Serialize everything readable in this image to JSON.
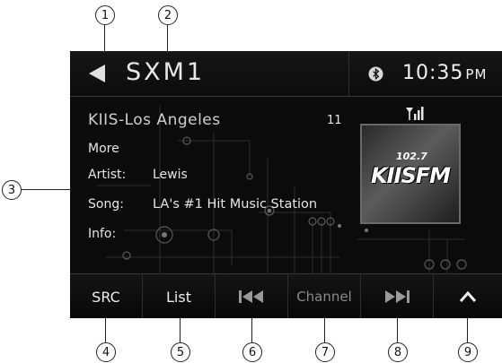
{
  "callouts": [
    "1",
    "2",
    "3",
    "4",
    "5",
    "6",
    "7",
    "8",
    "9"
  ],
  "header": {
    "source": "SXM1",
    "time": "10:35",
    "ampm": "PM",
    "back_icon": "back-triangle-icon",
    "bluetooth_icon": "bluetooth-icon"
  },
  "station": {
    "name": "KIIS-Los Angeles",
    "channel": "11",
    "more": "More",
    "artist_label": "Artist:",
    "artist": "Lewis",
    "song_label": "Song:",
    "song": "LA's #1 Hit Music Station",
    "info_label": "Info:",
    "signal_icon": "signal-strength-icon",
    "art_number": "102.7",
    "art_name": "KIISFM"
  },
  "toolbar": {
    "src": "SRC",
    "list": "List",
    "prev_icon": "skip-previous-icon",
    "channel": "Channel",
    "next_icon": "skip-next-icon",
    "up_icon": "chevron-up-icon"
  },
  "colors": {
    "screen_bg": "#0b0b0b",
    "text": "#e6e6e6",
    "dim_text": "#8a8a8a"
  }
}
